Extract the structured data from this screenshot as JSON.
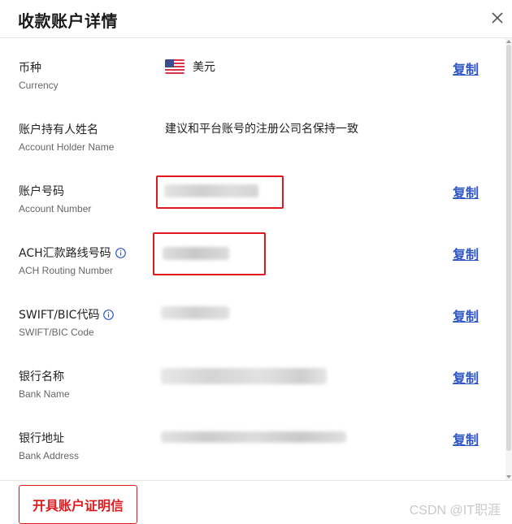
{
  "header": {
    "title": "收款账户详情",
    "close_icon": "close-icon"
  },
  "rows": [
    {
      "label_cn": "币种",
      "label_en": "Currency",
      "value": "美元",
      "copy": "复制"
    },
    {
      "label_cn": "账户持有人姓名",
      "label_en": "Account Holder Name",
      "value": "建议和平台账号的注册公司名保持一致"
    },
    {
      "label_cn": "账户号码",
      "label_en": "Account Number",
      "copy": "复制"
    },
    {
      "label_cn": "ACH汇款路线号码",
      "label_en": "ACH Routing Number",
      "copy": "复制"
    },
    {
      "label_cn": "SWIFT/BIC代码",
      "label_en": "SWIFT/BIC Code",
      "copy": "复制"
    },
    {
      "label_cn": "银行名称",
      "label_en": "Bank Name",
      "copy": "复制"
    },
    {
      "label_cn": "银行地址",
      "label_en": "Bank Address",
      "copy": "复制"
    }
  ],
  "footer": {
    "cert_button": "开具账户证明信",
    "watermark": "CSDN @IT职涯"
  },
  "colors": {
    "link": "#2f56c5",
    "highlight": "#e0191f",
    "primary_red": "#e0191f"
  }
}
